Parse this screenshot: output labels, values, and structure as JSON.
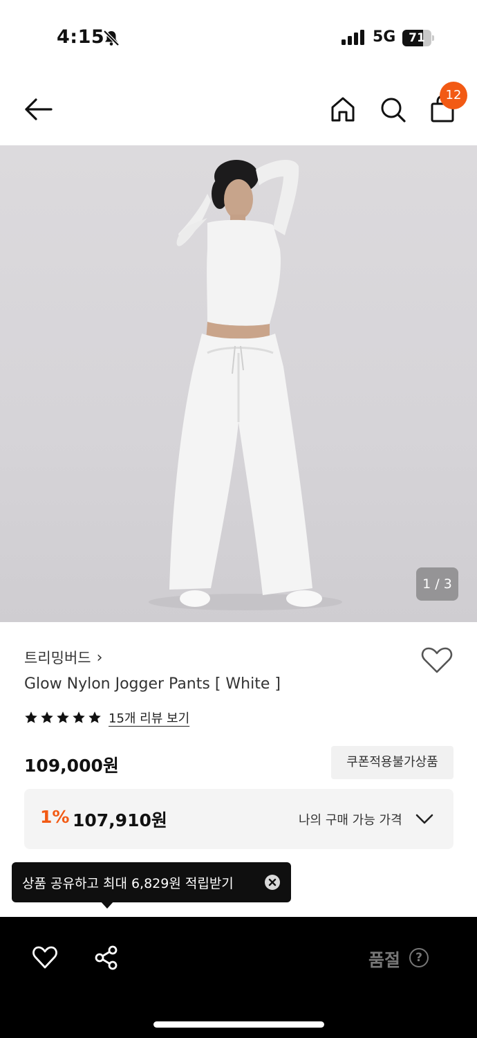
{
  "status_bar": {
    "time": "4:15",
    "network": "5G",
    "battery": 71,
    "icons": [
      "bell-off-icon",
      "signal-icon"
    ]
  },
  "header": {
    "icons": [
      "back-arrow-icon",
      "home-icon",
      "search-icon",
      "shopping-bag-icon"
    ],
    "cart_count": "12"
  },
  "gallery": {
    "counter": "1 / 3"
  },
  "product": {
    "brand": "트리밍버드",
    "brand_chevron": "›",
    "name": "Glow Nylon Jogger Pants [ White ]",
    "rating_stars": 5,
    "review_link": "15개 리뷰 보기",
    "price": "109,000원",
    "coupon_tag": "쿠폰적용불가상품"
  },
  "discount": {
    "rate": "1%",
    "price": "107,910원",
    "my_price_label": "나의 구매 가능 가격"
  },
  "tooltip": {
    "text": "상품 공유하고 최대 6,829원 적립받기"
  },
  "bottom_bar": {
    "sold_out_label": "품절",
    "help_symbol": "?"
  },
  "colors": {
    "accent": "#f25a14",
    "bottom_bar": "#000000",
    "sold_out_text": "#777777"
  }
}
